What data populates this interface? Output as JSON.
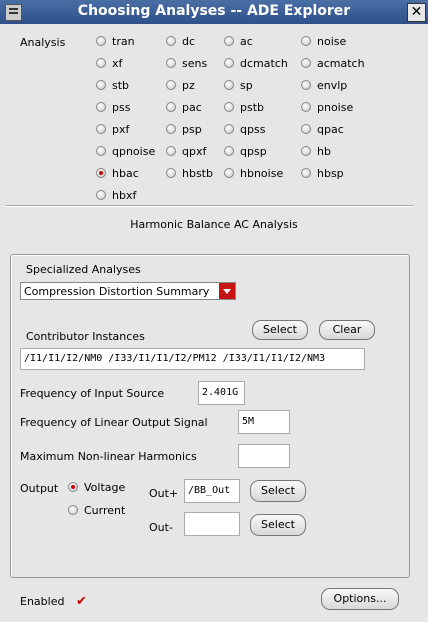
{
  "window": {
    "title": "Choosing Analyses -- ADE Explorer",
    "close_glyph": "✕"
  },
  "analysis_label": "Analysis",
  "analyses": [
    [
      "tran",
      "dc",
      "ac",
      "noise"
    ],
    [
      "xf",
      "sens",
      "dcmatch",
      "acmatch"
    ],
    [
      "stb",
      "pz",
      "sp",
      "envlp"
    ],
    [
      "pss",
      "pac",
      "pstb",
      "pnoise"
    ],
    [
      "pxf",
      "psp",
      "qpss",
      "qpac"
    ],
    [
      "qpnoise",
      "qpxf",
      "qpsp",
      "hb"
    ],
    [
      "hbac",
      "hbstb",
      "hbnoise",
      "hbsp"
    ],
    [
      "hbxf"
    ]
  ],
  "selected_analysis": "hbac",
  "section_title": "Harmonic Balance AC Analysis",
  "specialized": {
    "label": "Specialized Analyses",
    "value": "Compression Distortion Summary"
  },
  "contributor": {
    "label": "Contributor Instances",
    "select_label": "Select",
    "clear_label": "Clear",
    "value": "/I1/I1/I2/NM0 /I33/I1/I1/I2/PM12 /I33/I1/I1/I2/NM3"
  },
  "freq_input": {
    "label": "Frequency of Input Source",
    "value": "2.401G"
  },
  "freq_output": {
    "label": "Frequency of Linear Output Signal",
    "value": "5M"
  },
  "max_harmonics": {
    "label": "Maximum Non-linear Harmonics",
    "value": ""
  },
  "output": {
    "label": "Output",
    "voltage_label": "Voltage",
    "current_label": "Current",
    "selected": "Voltage",
    "outp_label": "Out+",
    "outp_value": "/BB_Out",
    "outm_label": "Out-",
    "outm_value": "",
    "select_label": "Select"
  },
  "enabled": {
    "label": "Enabled",
    "checked": true,
    "check_glyph": "✔"
  },
  "options_label": "Options..."
}
